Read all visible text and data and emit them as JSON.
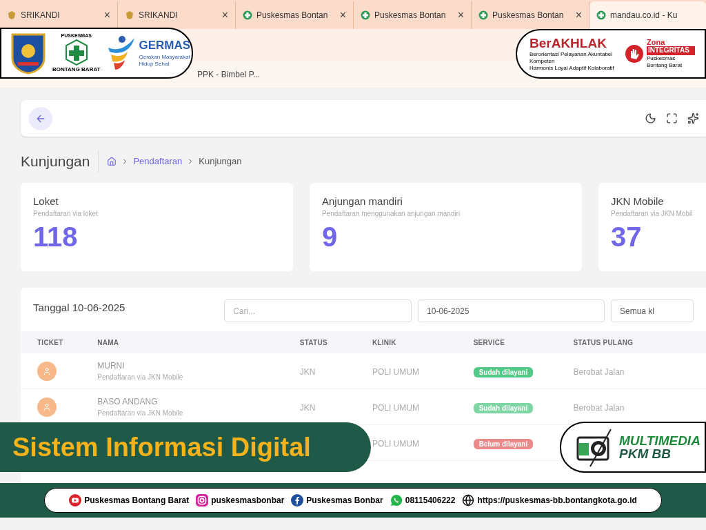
{
  "browser_tabs": [
    {
      "title": "SRIKANDI",
      "kind": "emblem",
      "selected": false
    },
    {
      "title": "SRIKANDI",
      "kind": "emblem",
      "selected": false
    },
    {
      "title": "Puskesmas Bontan",
      "kind": "cross",
      "selected": false
    },
    {
      "title": "Puskesmas Bontan",
      "kind": "cross",
      "selected": false
    },
    {
      "title": "Puskesmas Bontan",
      "kind": "cross",
      "selected": false
    },
    {
      "title": "mandau.co.id - Ku",
      "kind": "cross",
      "selected": true
    }
  ],
  "tab_close": "×",
  "bookmark": "PPK - Bimbel P...",
  "page_title": "Kunjungan",
  "breadcrumbs": [
    {
      "label": "Pendaftaran",
      "link": true
    },
    {
      "label": "Kunjungan",
      "link": false
    }
  ],
  "stat_cards": [
    {
      "title": "Loket",
      "subtitle": "Pendaftaran via loket",
      "value": "118"
    },
    {
      "title": "Anjungan mandiri",
      "subtitle": "Pendaftaran menggunakan anjungan mandiri",
      "value": "9"
    },
    {
      "title": "JKN Mobile",
      "subtitle": "Pendaftaran via JKN Mobil",
      "value": "37"
    }
  ],
  "table_title": "Tanggal 10-06-2025",
  "search": {
    "placeholder": "Cari..."
  },
  "date_field": {
    "value": "10-06-2025"
  },
  "clinic_select": {
    "value": "Semua kl"
  },
  "table": {
    "columns": [
      "TICKET",
      "NAMA",
      "STATUS",
      "KLINIK",
      "SERVICE",
      "STATUS PULANG"
    ],
    "rows": [
      {
        "nama": "MURNI",
        "source": "Pendaftaran via JKN Mobile",
        "status": "JKN",
        "klinik": "POLI UMUM",
        "service": "Sudah dilayani",
        "color": "#4fc985",
        "status_pulang": "Berobat Jalan"
      },
      {
        "nama": "BASO ANDANG",
        "source": "Pendaftaran via JKN Mobile",
        "status": "JKN",
        "klinik": "POLI UMUM",
        "service": "Sudah dilayani",
        "color": "#7fd6a5",
        "status_pulang": "Berobat Jalan"
      },
      {
        "klinik": "POLI UMUM",
        "service": "Belum dilayani",
        "color": "#ec8a8a"
      }
    ]
  },
  "overlay": {
    "logo_left": {
      "puskesmas": "PUSKESMAS",
      "puskesmas_place": "BONTANG BARAT",
      "germas": "GERMAS",
      "germas_tagline": "Gerakan Masyarakat Hidup Sehat"
    },
    "logo_right": {
      "berakhlak": "BerAKHLAK",
      "berakhlak_line1": "Berorientasi Pelayanan Akuntabel Kompeten",
      "berakhlak_line2": "Harmonis Loyal Adaptif Kolaboratif",
      "zona": "Zona",
      "integritas": "INTEGRITAS",
      "zona_place": "Puskesmas Bontang Barat"
    },
    "banner": "Sistem Informasi Digital",
    "multimedia": {
      "line1": "MULTIMEDIA",
      "line2": "PKM BB"
    },
    "footer": [
      {
        "kind": "youtube",
        "label": "Puskesmas Bontang Barat"
      },
      {
        "kind": "instagram",
        "label": "puskesmasbonbar"
      },
      {
        "kind": "facebook",
        "label": "Puskesmas Bonbar"
      },
      {
        "kind": "whatsapp",
        "label": "08115406222"
      },
      {
        "kind": "web",
        "label": "https://puskesmas-bb.bontangkota.go.id"
      }
    ]
  }
}
